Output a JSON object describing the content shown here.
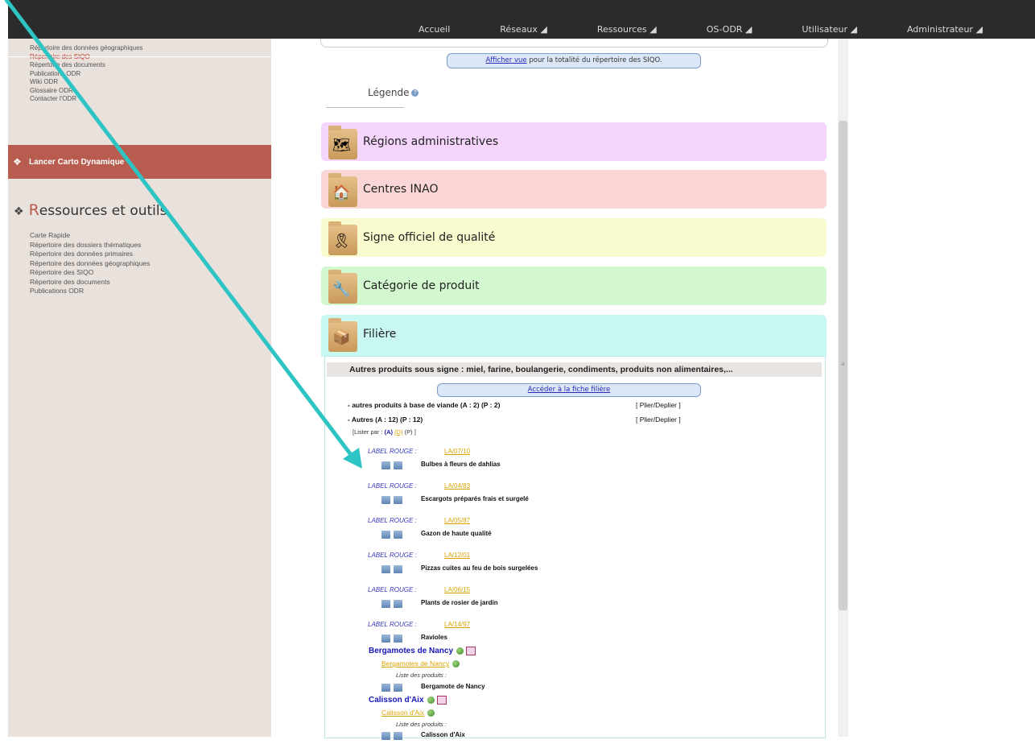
{
  "topnav": [
    "Accueil",
    "Réseaux ◢",
    "Ressources ◢",
    "OS-ODR ◢",
    "Utilisateur ◢",
    "Administrateur ◢"
  ],
  "sidebar": {
    "top_links": [
      "Répertoire des données géographiques",
      "Répertoire des SIQO",
      "Répertoire des documents",
      "Publications ODR",
      "Wiki ODR",
      "Glossaire ODR",
      "Contacter l'ODR"
    ],
    "launch_label": "Lancer Carto Dynamique",
    "resources_title_first": "R",
    "resources_title_rest": "essources et outils",
    "resources_links": [
      "Carte Rapide",
      "Répertoire des dossiers thématiques",
      "Répertoire des données primaires",
      "Répertoire des données géographiques",
      "Répertoire des SIQO",
      "Répertoire des documents",
      "Publications ODR"
    ]
  },
  "main": {
    "view_link": "Afficher vue",
    "view_text": " pour la totalité du répertoire des SIQO.",
    "legend": "Légende",
    "categories": [
      {
        "label": "Régions administratives",
        "color": "#f5d5fb"
      },
      {
        "label": "Centres INAO",
        "color": "#fbd6d6"
      },
      {
        "label": "Signe officiel de qualité",
        "color": "#f9fbcf"
      },
      {
        "label": "Catégorie de produit",
        "color": "#d3f8cf"
      },
      {
        "label": "Filière",
        "color": "#c9f8f2"
      }
    ],
    "filiere_title": "Autres produits sous signe : miel, farine, boulangerie, condiments, produits non alimentaires,...",
    "fiche_link": "Accéder à la fiche filière",
    "tree": [
      {
        "label": "- autres produits à base de viande (A : 2) (P : 2)",
        "action": "[ Plier/Deplier ]"
      },
      {
        "label": "- Autres (A : 12) (P : 12)",
        "action": "[ Plier/Deplier ]"
      }
    ],
    "lister": {
      "prefix": "[Lister par :",
      "a": "(A)",
      "d": "(D)",
      "p": "(P) ]"
    },
    "labels": [
      {
        "type": "LABEL ROUGE :",
        "code": "LA/07/10",
        "product": "Bulbes à fleurs de dahlias"
      },
      {
        "type": "LABEL ROUGE :",
        "code": "LA/04/83",
        "product": "Escargots préparés frais et surgelé"
      },
      {
        "type": "LABEL ROUGE :",
        "code": "LA/05/87",
        "product": "Gazon de haute qualité"
      },
      {
        "type": "LABEL ROUGE :",
        "code": "LA/12/01",
        "product": "Pizzas cuites au feu de bois surgelées"
      },
      {
        "type": "LABEL ROUGE :",
        "code": "LA/06/15",
        "product": "Plants de rosier de jardin"
      },
      {
        "type": "LABEL ROUGE :",
        "code": "LA/14/97",
        "product": "Ravioles"
      }
    ],
    "igs": [
      {
        "name": "Bergamotes de Nancy",
        "sub": "Bergamotes de Nancy",
        "list_label": "Liste des produits :",
        "product": "Bergamote de Nancy"
      },
      {
        "name": "Calisson d'Aix",
        "sub": "Calisson d'Aix",
        "list_label": "Liste des produits :",
        "product": "Calisson d'Aix"
      }
    ]
  },
  "colors": {
    "accent": "#b85c4f",
    "arrow": "#2ec4c4",
    "link": "#2a2ab8",
    "code": "#d9a400"
  }
}
